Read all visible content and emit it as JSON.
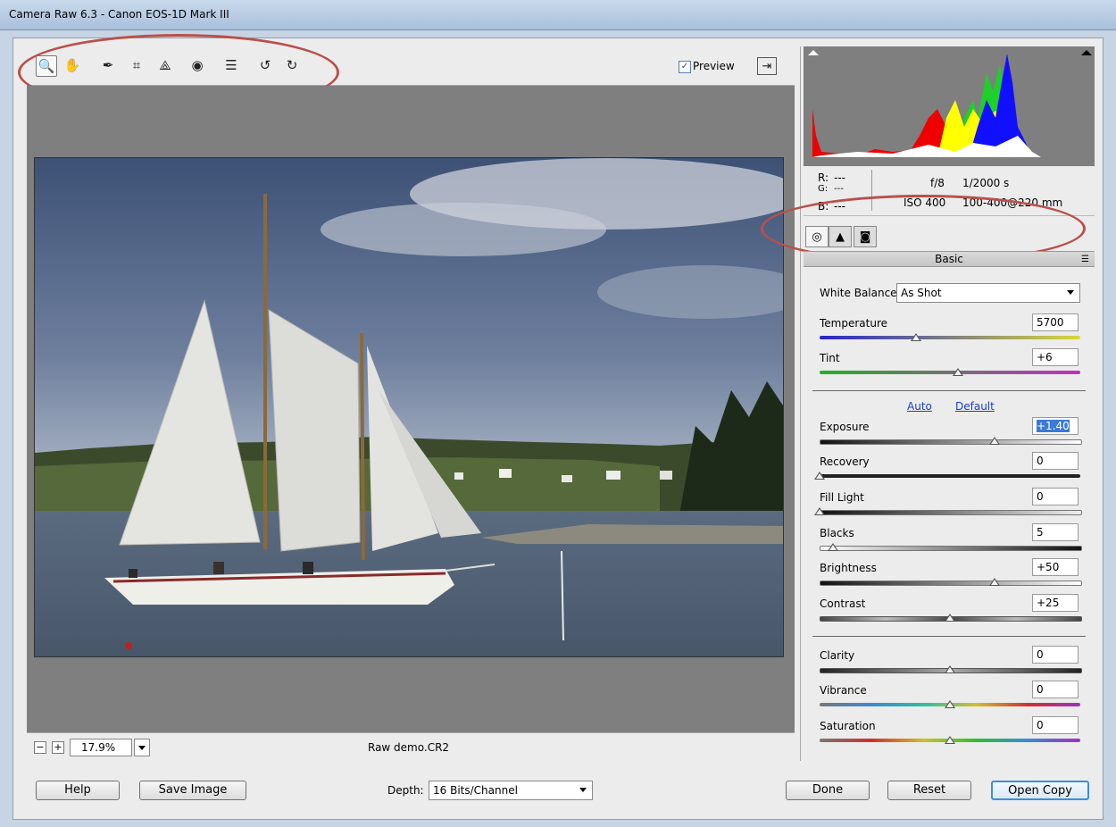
{
  "window": {
    "title": "Camera Raw 6.3  -  Canon EOS-1D Mark III"
  },
  "toolbar": {
    "tools": [
      {
        "name": "zoom-tool",
        "icon": "zoom-icon",
        "glyph": "🔍"
      },
      {
        "name": "hand-tool",
        "icon": "hand-icon",
        "glyph": "✋"
      },
      {
        "name": "white-balance-tool",
        "icon": "eyedropper-icon",
        "glyph": "✒"
      },
      {
        "name": "crop-tool",
        "icon": "crop-icon",
        "glyph": "⌗"
      },
      {
        "name": "straighten-tool",
        "icon": "straighten-icon",
        "glyph": "⟁"
      },
      {
        "name": "red-eye-tool",
        "icon": "red-eye-icon",
        "glyph": "◉"
      },
      {
        "name": "preferences-tool",
        "icon": "list-icon",
        "glyph": "☰"
      },
      {
        "name": "rotate-left-tool",
        "icon": "rotate-left-icon",
        "glyph": "↺"
      },
      {
        "name": "rotate-right-tool",
        "icon": "rotate-right-icon",
        "glyph": "↻"
      }
    ],
    "preview_label": "Preview",
    "preview_checked": true,
    "fullscreen_glyph": "⇥"
  },
  "status": {
    "zoom_value": "17.9%",
    "filename": "Raw demo.CR2",
    "zoom_out": "−",
    "zoom_in": "+"
  },
  "info": {
    "r_label": "R:",
    "r_value": "---",
    "g_label": "G:",
    "g_value": "---",
    "b_label": "B:",
    "b_value": "---",
    "aperture": "f/8",
    "shutter": "1/2000 s",
    "iso": "ISO 400",
    "lens": "100-400@220 mm"
  },
  "panel": {
    "title": "Basic",
    "white_balance_label": "White Balance:",
    "white_balance_value": "As Shot",
    "auto_label": "Auto",
    "default_label": "Default",
    "sliders": [
      {
        "label": "Temperature",
        "value": "5700",
        "pos": 0.37
      },
      {
        "label": "Tint",
        "value": "+6",
        "pos": 0.53
      },
      {
        "label": "Exposure",
        "value": "+1.40",
        "pos": 0.67
      },
      {
        "label": "Recovery",
        "value": "0",
        "pos": 0.0
      },
      {
        "label": "Fill Light",
        "value": "0",
        "pos": 0.0
      },
      {
        "label": "Blacks",
        "value": "5",
        "pos": 0.05
      },
      {
        "label": "Brightness",
        "value": "+50",
        "pos": 0.67
      },
      {
        "label": "Contrast",
        "value": "+25",
        "pos": 0.5
      },
      {
        "label": "Clarity",
        "value": "0",
        "pos": 0.5
      },
      {
        "label": "Vibrance",
        "value": "0",
        "pos": 0.5
      },
      {
        "label": "Saturation",
        "value": "0",
        "pos": 0.5
      }
    ]
  },
  "buttons": {
    "help": "Help",
    "save_image": "Save Image",
    "depth_label": "Depth:",
    "depth_value": "16 Bits/Channel",
    "done": "Done",
    "reset": "Reset",
    "open_copy": "Open Copy"
  },
  "colors": {
    "annotation": "#b9504a",
    "accent": "#3c8fd9",
    "link": "#1a3fd0"
  }
}
